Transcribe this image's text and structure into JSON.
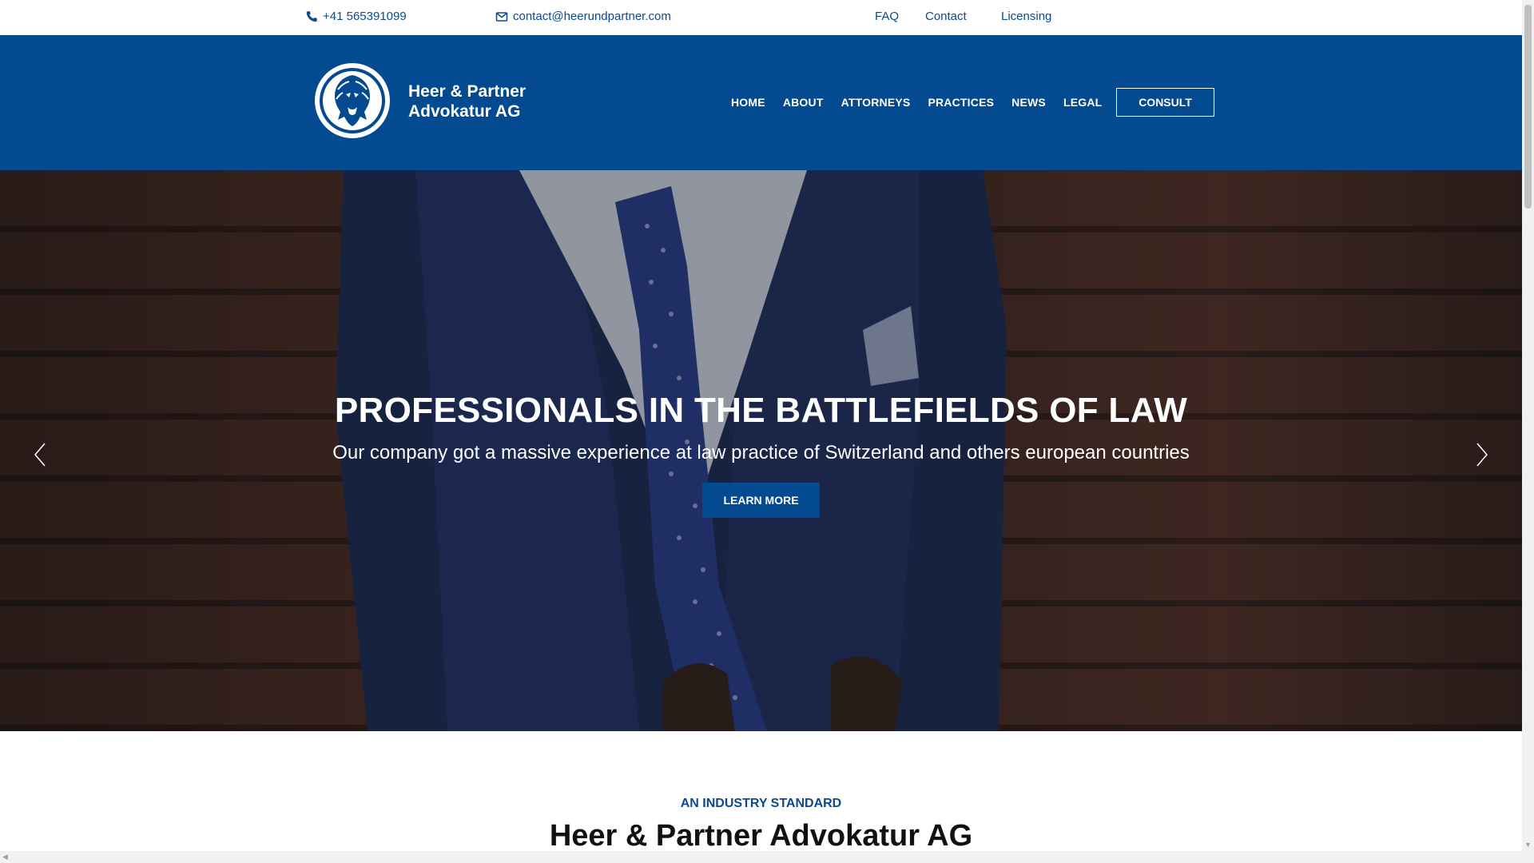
{
  "topbar": {
    "phone": "+41 565391099",
    "email": "contact@heerundpartner.com",
    "links": [
      "FAQ",
      "Contact",
      "Licensing"
    ]
  },
  "header": {
    "brand_line1": "Heer & Partner",
    "brand_line2": "Advokatur AG",
    "nav": [
      "HOME",
      "ABOUT",
      "ATTORNEYS",
      "PRACTICES",
      "NEWS",
      "LEGAL"
    ],
    "consult_label": "CONSULT"
  },
  "hero": {
    "title": "PROFESSIONALS IN THE BATTLEFIELDS OF LAW",
    "subtitle": "Our company got a massive experience at law practice of Switzerland and others european countries",
    "button_label": "LEARN MORE"
  },
  "intro": {
    "tag": "AN INDUSTRY STANDARD",
    "title": "Heer & Partner Advokatur AG"
  },
  "colors": {
    "brand_blue": "#044a91",
    "link_blue": "#0b4a8e"
  },
  "icons": {
    "phone": "phone-icon",
    "email": "envelope-icon",
    "logo": "lion-logo-icon",
    "prev": "chevron-left-icon",
    "next": "chevron-right-icon"
  }
}
